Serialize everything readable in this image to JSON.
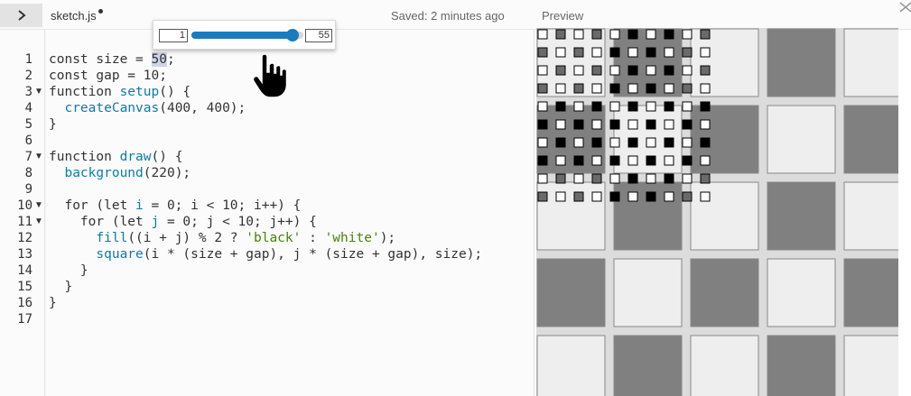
{
  "header": {
    "toggle_icon": "chevron-right-icon",
    "file_name": "sketch.js",
    "saved_status": "Saved: 2 minutes ago",
    "preview_label": "Preview"
  },
  "editor": {
    "line_numbers": [
      "1",
      "2",
      "3",
      "4",
      "5",
      "6",
      "7",
      "8",
      "9",
      "10",
      "11",
      "12",
      "13",
      "14",
      "15",
      "16",
      "17"
    ],
    "fold_arrows": [
      "▼",
      "▼",
      "▼",
      "▼"
    ]
  },
  "code": {
    "l1_a": "const size = ",
    "l1_num": "50",
    "l1_b": ";",
    "l2": "const gap = 10;",
    "l3_kw": "function ",
    "l3_fn": "setup",
    "l3_b": "() {",
    "l4_indent": "  ",
    "l4_fn": "createCanvas",
    "l4_b": "(400, 400);",
    "l5": "}",
    "l7_kw": "function ",
    "l7_fn": "draw",
    "l7_b": "() {",
    "l8_indent": "  ",
    "l8_fn": "background",
    "l8_b": "(220);",
    "l10_a": "  for (let ",
    "l10_i": "i",
    "l10_b": " = 0; i < 10; i++) {",
    "l11_a": "    for (let ",
    "l11_j": "j",
    "l11_b": " = 0; j < 10; j++) {",
    "l12_indent": "      ",
    "l12_fn": "fill",
    "l12_a": "((i + j) % 2 ? ",
    "l12_s1": "'black'",
    "l12_b": " : ",
    "l12_s2": "'white'",
    "l12_c": ");",
    "l13_indent": "      ",
    "l13_fn": "square",
    "l13_a": "(i * (size + gap), j * (size + gap), size);",
    "l14": "    }",
    "l15": "  }",
    "l16": "}"
  },
  "slider": {
    "min": "1",
    "max": "55",
    "value_fraction": 0.9
  },
  "preview_sketch": {
    "background": "#dcdcdc",
    "colors": {
      "cell_light": "#eeeeee",
      "cell_dark": "#808080",
      "small_black": "#000000",
      "small_white": "#ffffff",
      "small_gray": "#6a6a6a"
    }
  },
  "colors": {
    "accent": "#1a7bbf",
    "function_name": "#0b7ca9",
    "string": "#47820a",
    "highlight": "#cfd5e8"
  }
}
